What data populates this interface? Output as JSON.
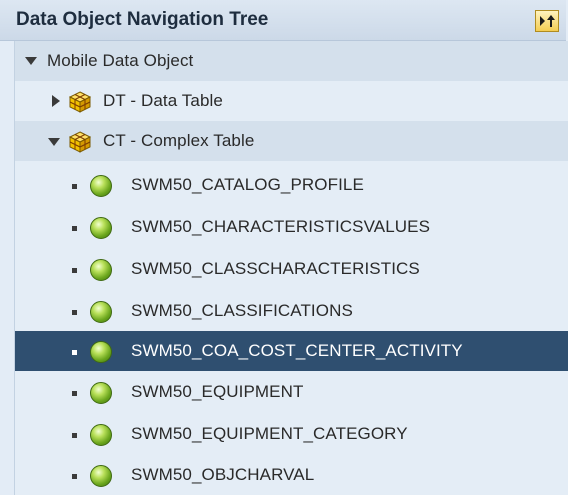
{
  "panel": {
    "title": "Data Object Navigation Tree",
    "header_button_icon": "expand-collapse-icon"
  },
  "tree": {
    "root": {
      "label": "Mobile Data Object",
      "expanded": true
    },
    "groups": [
      {
        "label": "DT - Data Table",
        "expanded": false,
        "icon": "table-cube-icon"
      },
      {
        "label": "CT - Complex Table",
        "expanded": true,
        "icon": "table-cube-icon"
      }
    ],
    "items": [
      {
        "label": "SWM50_CATALOG_PROFILE",
        "selected": false
      },
      {
        "label": "SWM50_CHARACTERISTICSVALUES",
        "selected": false
      },
      {
        "label": "SWM50_CLASSCHARACTERISTICS",
        "selected": false
      },
      {
        "label": "SWM50_CLASSIFICATIONS",
        "selected": false
      },
      {
        "label": "SWM50_COA_COST_CENTER_ACTIVITY",
        "selected": true
      },
      {
        "label": "SWM50_EQUIPMENT",
        "selected": false
      },
      {
        "label": "SWM50_EQUIPMENT_CATEGORY",
        "selected": false
      },
      {
        "label": "SWM50_OBJCHARVAL",
        "selected": false
      }
    ]
  },
  "colors": {
    "header_bg": "#d3deeb",
    "tree_bg": "#e4edf6",
    "band_bg": "#d4e0ec",
    "selected_bg": "#2f4f70",
    "status_green": "#6aa51c"
  }
}
